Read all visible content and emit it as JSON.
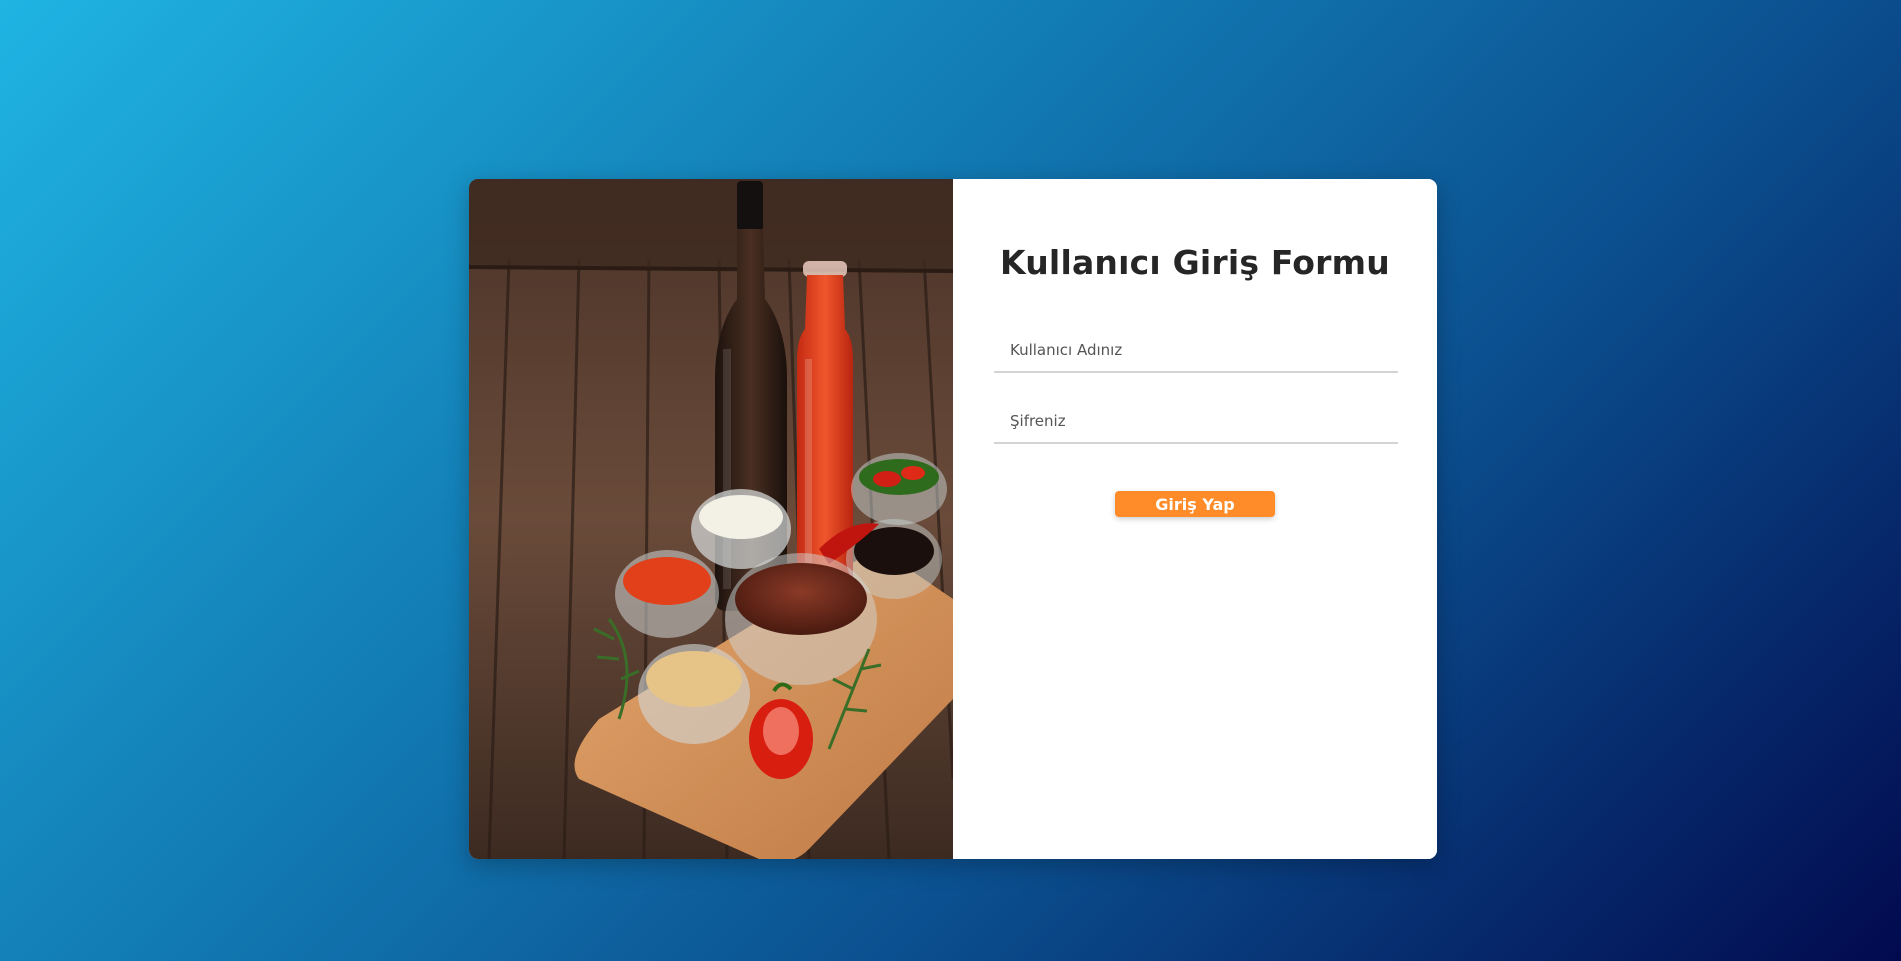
{
  "form": {
    "title": "Kullanıcı Giriş Formu",
    "username_placeholder": "Kullanıcı Adınız",
    "username_value": "",
    "password_placeholder": "Şifreniz",
    "password_value": "",
    "submit_label": "Giriş Yap"
  },
  "colors": {
    "background_start": "#1fb4e3",
    "background_end": "#020a4e",
    "card": "#ffffff",
    "title_text": "#262626",
    "button": "#ff8c28",
    "button_text": "#ffffff",
    "field_underline": "#d4d4d4"
  },
  "image": {
    "subject": "sauces-and-condiments-photo"
  }
}
